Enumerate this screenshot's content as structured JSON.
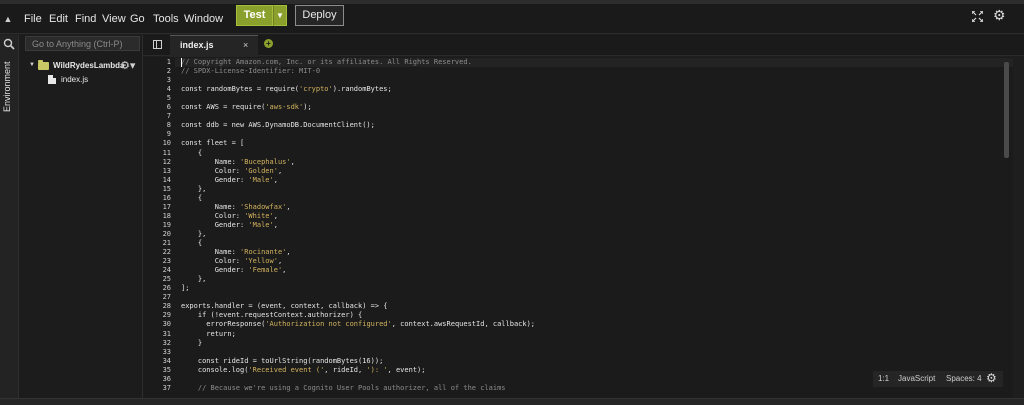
{
  "menu": {
    "items": [
      "File",
      "Edit",
      "Find",
      "View",
      "Go",
      "Tools",
      "Window"
    ],
    "test_label": "Test",
    "deploy_label": "Deploy"
  },
  "sidebar": {
    "environment_label": "Environment",
    "search_placeholder": "Go to Anything (Ctrl-P)",
    "folder_name": "WildRydesLambda -",
    "file_name": "index.js"
  },
  "editor": {
    "tab_label": "index.js",
    "close_glyph": "×",
    "lines": [
      "// Copyright Amazon.com, Inc. or its affiliates. All Rights Reserved.",
      "// SPDX-License-Identifier: MIT-0",
      "",
      "const randomBytes = require('crypto').randomBytes;",
      "",
      "const AWS = require('aws-sdk');",
      "",
      "const ddb = new AWS.DynamoDB.DocumentClient();",
      "",
      "const fleet = [",
      "    {",
      "        Name: 'Bucephalus',",
      "        Color: 'Golden',",
      "        Gender: 'Male',",
      "    },",
      "    {",
      "        Name: 'Shadowfax',",
      "        Color: 'White',",
      "        Gender: 'Male',",
      "    },",
      "    {",
      "        Name: 'Rocinante',",
      "        Color: 'Yellow',",
      "        Gender: 'Female',",
      "    },",
      "];",
      "",
      "exports.handler = (event, context, callback) => {",
      "    if (!event.requestContext.authorizer) {",
      "      errorResponse('Authorization not configured', context.awsRequestId, callback);",
      "      return;",
      "    }",
      "",
      "    const rideId = toUrlString(randomBytes(16));",
      "    console.log('Received event (', rideId, '): ', event);",
      "",
      "    // Because we're using a Cognito User Pools authorizer, all of the claims"
    ]
  },
  "status": {
    "position": "1:1",
    "language": "JavaScript",
    "spaces": "Spaces: 4"
  },
  "colors": {
    "accent": "#8aa02c",
    "string": "#d3b35f",
    "comment": "#8c8c8c"
  }
}
